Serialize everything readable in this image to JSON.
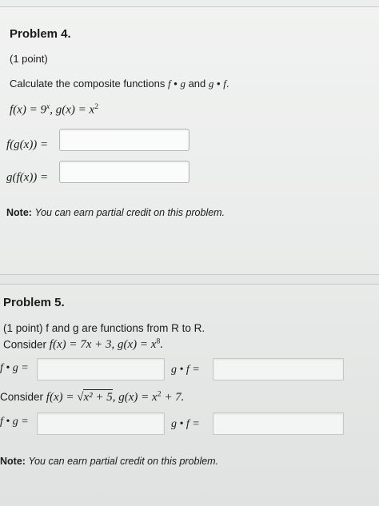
{
  "problem4": {
    "title": "Problem 4.",
    "points": "(1 point)",
    "prompt_text": "Calculate the composite functions",
    "prompt_f": "f",
    "prompt_dot": "•",
    "prompt_g": "g",
    "prompt_and": "and",
    "prompt_g2": "g",
    "prompt_dot2": "•",
    "prompt_f2": "f",
    "prompt_end": ".",
    "definition_f": "f(x) = 9",
    "definition_exp": "x",
    "definition_g": ", g(x) = x",
    "definition_g_exp": "2",
    "label_fg": "f(g(x)) =",
    "label_gf": "g(f(x)) =",
    "answer_fg": "",
    "answer_gf": "",
    "note_label": "Note:",
    "note_text": "You can earn partial credit on this problem."
  },
  "problem5": {
    "title": "Problem 5.",
    "intro": "(1 point) f and g are functions from R to R.",
    "consider1_label": "Consider",
    "consider1_math": "f(x) = 7x + 3, g(x) = x",
    "consider1_exp": "8",
    "consider1_end": ".",
    "fg_label": "f • g =",
    "gf_label": "g • f =",
    "consider2_label": "Consider",
    "consider2_math_a": "f(x) = ",
    "consider2_radical": "x² + 5",
    "consider2_math_b": ", g(x) = x",
    "consider2_exp": "2",
    "consider2_math_c": " + 7.",
    "fg2_label": "f • g =",
    "gf2_label": "g • f =",
    "answer_fg1": "",
    "answer_gf1": "",
    "answer_fg2": "",
    "answer_gf2": "",
    "note_label": "Note:",
    "note_text": "You can earn partial credit on this problem."
  }
}
